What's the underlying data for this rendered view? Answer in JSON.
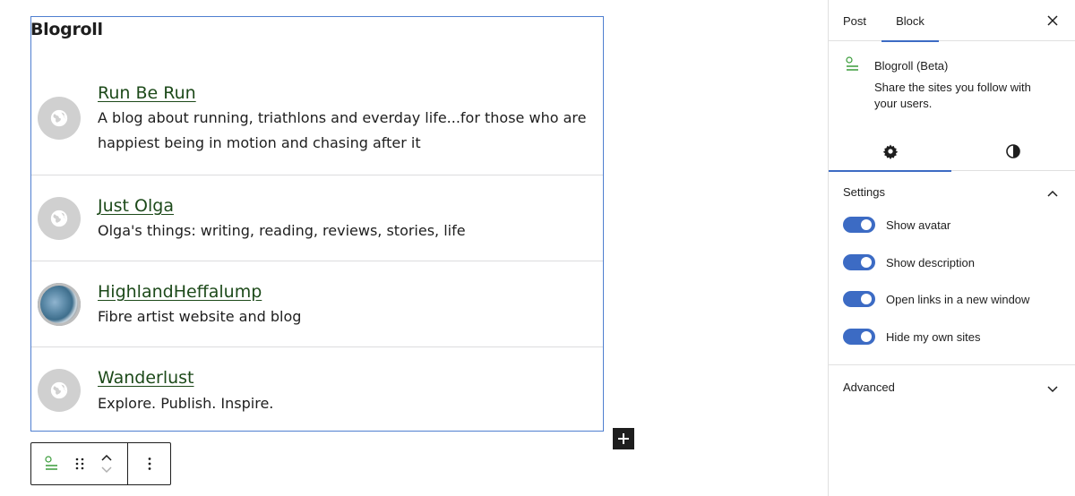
{
  "blogroll": {
    "title": "Blogroll",
    "sites": [
      {
        "name": "Run Be Run",
        "description": "A blog about running, triathlons and everday life...for those who are happiest being in motion and chasing after it",
        "avatar": "globe-icon"
      },
      {
        "name": "Just Olga",
        "description": "Olga's things: writing, reading, reviews, stories, life",
        "avatar": "globe-icon"
      },
      {
        "name": "HighlandHeffalump",
        "description": "Fibre artist website and blog",
        "avatar": "site-photo"
      },
      {
        "name": "Wanderlust",
        "description": "Explore. Publish. Inspire.",
        "avatar": "globe-icon"
      }
    ]
  },
  "toolbar": {
    "block_icon": "blogroll-icon",
    "drag_icon": "drag-handle-icon",
    "move_icon": "chevron-up-down-icon",
    "options_icon": "more-vertical-icon"
  },
  "sidebar": {
    "tabs": [
      {
        "label": "Post",
        "active": false
      },
      {
        "label": "Block",
        "active": true
      }
    ],
    "close_icon": "close-icon",
    "block_card": {
      "title": "Blogroll (Beta)",
      "description": "Share the sites you follow with your users."
    },
    "sub_tabs": [
      {
        "icon": "gear-icon",
        "active": true
      },
      {
        "icon": "contrast-icon",
        "active": false
      }
    ],
    "settings": {
      "title": "Settings",
      "expanded": true,
      "toggles": [
        {
          "label": "Show avatar",
          "on": true
        },
        {
          "label": "Show description",
          "on": true
        },
        {
          "label": "Open links in a new window",
          "on": true
        },
        {
          "label": "Hide my own sites",
          "on": true
        }
      ]
    },
    "advanced": {
      "title": "Advanced",
      "expanded": false
    }
  },
  "colors": {
    "accent": "#3c6bc4",
    "link": "#1d4a1a",
    "icon_green": "#3a9c3a",
    "avatar_bg": "#d0d0d0"
  }
}
